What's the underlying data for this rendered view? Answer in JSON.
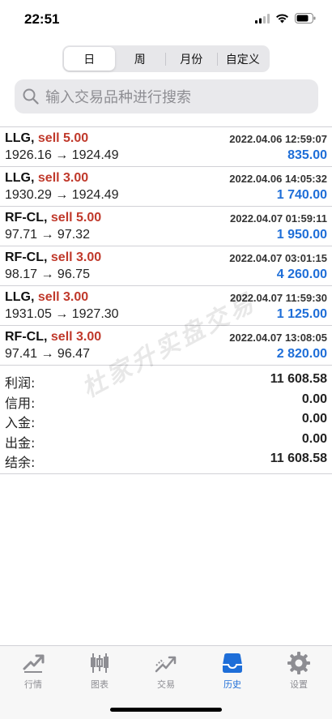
{
  "status_bar": {
    "time": "22:51"
  },
  "period_tabs": [
    {
      "label": "日",
      "active": true
    },
    {
      "label": "周",
      "active": false
    },
    {
      "label": "月份",
      "active": false
    },
    {
      "label": "自定义",
      "active": false
    }
  ],
  "search": {
    "placeholder": "输入交易品种进行搜索"
  },
  "orders": [
    {
      "symbol": "LLG,",
      "side": "sell 5.00",
      "time": "2022.04.06 12:59:07",
      "prices": "1926.16 → 1924.49",
      "profit": "835.00"
    },
    {
      "symbol": "LLG,",
      "side": "sell 3.00",
      "time": "2022.04.06 14:05:32",
      "prices": "1930.29 → 1924.49",
      "profit": "1 740.00"
    },
    {
      "symbol": "RF-CL,",
      "side": "sell 5.00",
      "time": "2022.04.07 01:59:11",
      "prices": "97.71 → 97.32",
      "profit": "1 950.00"
    },
    {
      "symbol": "RF-CL,",
      "side": "sell 3.00",
      "time": "2022.04.07 03:01:15",
      "prices": "98.17 → 96.75",
      "profit": "4 260.00"
    },
    {
      "symbol": "LLG,",
      "side": "sell 3.00",
      "time": "2022.04.07 11:59:30",
      "prices": "1931.05 → 1927.30",
      "profit": "1 125.00"
    },
    {
      "symbol": "RF-CL,",
      "side": "sell 3.00",
      "time": "2022.04.07 13:08:05",
      "prices": "97.41 → 96.47",
      "profit": "2 820.00"
    }
  ],
  "summary": [
    {
      "label": "利润:",
      "value": "11 608.58"
    },
    {
      "label": "信用:",
      "value": "0.00"
    },
    {
      "label": "入金:",
      "value": "0.00"
    },
    {
      "label": "出金:",
      "value": "0.00"
    },
    {
      "label": "结余:",
      "value": "11 608.58"
    }
  ],
  "watermark": "杜家升实盘交易",
  "tabbar": [
    {
      "label": "行情",
      "icon": "quotes-icon",
      "active": false
    },
    {
      "label": "图表",
      "icon": "chart-icon",
      "active": false
    },
    {
      "label": "交易",
      "icon": "trade-icon",
      "active": false
    },
    {
      "label": "历史",
      "icon": "history-icon",
      "active": true
    },
    {
      "label": "设置",
      "icon": "settings-icon",
      "active": false
    }
  ],
  "colors": {
    "accent": "#1e6ed8",
    "sell": "#c0392b",
    "inactive": "#8e8e93"
  }
}
